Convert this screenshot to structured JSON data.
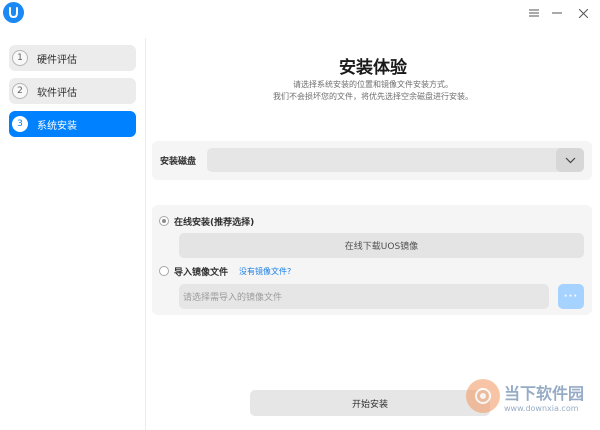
{
  "titlebar": {
    "logo_icon": "uos-logo-icon",
    "menu_icon": "hamburger-menu-icon",
    "minimize_icon": "minimize-icon",
    "close_icon": "close-icon"
  },
  "sidebar": {
    "items": [
      {
        "number": "1",
        "label": "硬件评估",
        "active": false
      },
      {
        "number": "2",
        "label": "软件评估",
        "active": false
      },
      {
        "number": "3",
        "label": "系统安装",
        "active": true
      }
    ]
  },
  "main": {
    "title": "安装体验",
    "subtitle_line1": "请选择系统安装的位置和镜像文件安装方式。",
    "subtitle_line2": "我们不会损坏您的文件，将优先选择空余磁盘进行安装。",
    "disk": {
      "label": "安装磁盘",
      "selected_value": "",
      "arrow_icon": "chevron-down-icon"
    },
    "online": {
      "label": "在线安装(推荐选择)",
      "selected": true,
      "button_label": "在线下载UOS镜像"
    },
    "image": {
      "label": "导入镜像文件",
      "link": "没有镜像文件?",
      "selected": false,
      "placeholder": "请选择需导入的镜像文件",
      "browse_label": "···"
    },
    "start_button": "开始安装"
  },
  "watermark": {
    "title": "当下软件园",
    "url": "www.downxia.com"
  },
  "colors": {
    "accent": "#0081ff",
    "link": "#1b7fe6",
    "browse": "#a6d2ff"
  }
}
